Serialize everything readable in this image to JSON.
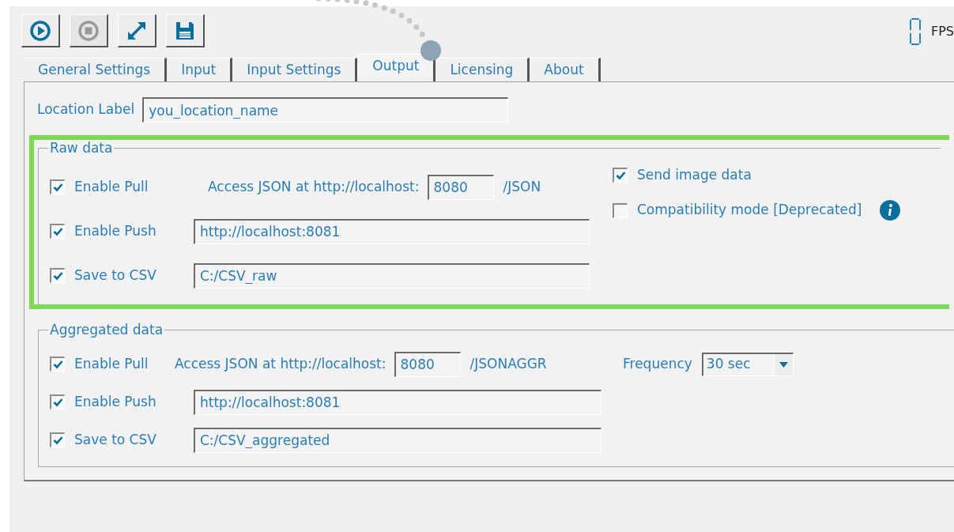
{
  "toolbar": [
    {
      "kind": "play",
      "disabled": false
    },
    {
      "kind": "stop",
      "disabled": true
    },
    {
      "kind": "expand",
      "disabled": false
    },
    {
      "kind": "save",
      "disabled": false
    }
  ],
  "fps": {
    "label": "FPS"
  },
  "tabs": [
    {
      "label": "General Settings",
      "selected": false
    },
    {
      "label": "Input",
      "selected": false
    },
    {
      "label": "Input Settings",
      "selected": false
    },
    {
      "label": "Output",
      "selected": true
    },
    {
      "label": "Licensing",
      "selected": false
    },
    {
      "label": "About",
      "selected": false
    }
  ],
  "location": {
    "label": "Location Label",
    "value": "you_location_name"
  },
  "groups": [
    {
      "title": "Raw data",
      "highlighted": true,
      "rows": [
        {
          "kind": "port",
          "label": "Enable Pull",
          "checked": true,
          "prefix": "Access JSON at http://localhost:",
          "value": "8080",
          "suffix": "/JSON"
        },
        {
          "kind": "path",
          "label": "Enable Push",
          "checked": true,
          "value": "http://localhost:8081"
        },
        {
          "kind": "path",
          "label": "Save to CSV",
          "checked": true,
          "value": "C:/CSV_raw"
        }
      ],
      "options": [
        {
          "label": "Send image data",
          "checked": true,
          "info": false
        },
        {
          "label": "Compatibility mode [Deprecated]",
          "checked": false,
          "info": true
        }
      ]
    },
    {
      "title": "Aggregated data",
      "highlighted": false,
      "rows": [
        {
          "kind": "port",
          "label": "Enable Pull",
          "checked": true,
          "prefix": "Access JSON at http://localhost:",
          "value": "8080",
          "suffix": "/JSONAGGR"
        },
        {
          "kind": "path",
          "label": "Enable Push",
          "checked": true,
          "value": "http://localhost:8081"
        },
        {
          "kind": "path",
          "label": "Save to CSV",
          "checked": true,
          "value": "C:/CSV_aggregated"
        }
      ],
      "frequency": {
        "label": "Frequency",
        "value": "30 sec"
      }
    }
  ]
}
